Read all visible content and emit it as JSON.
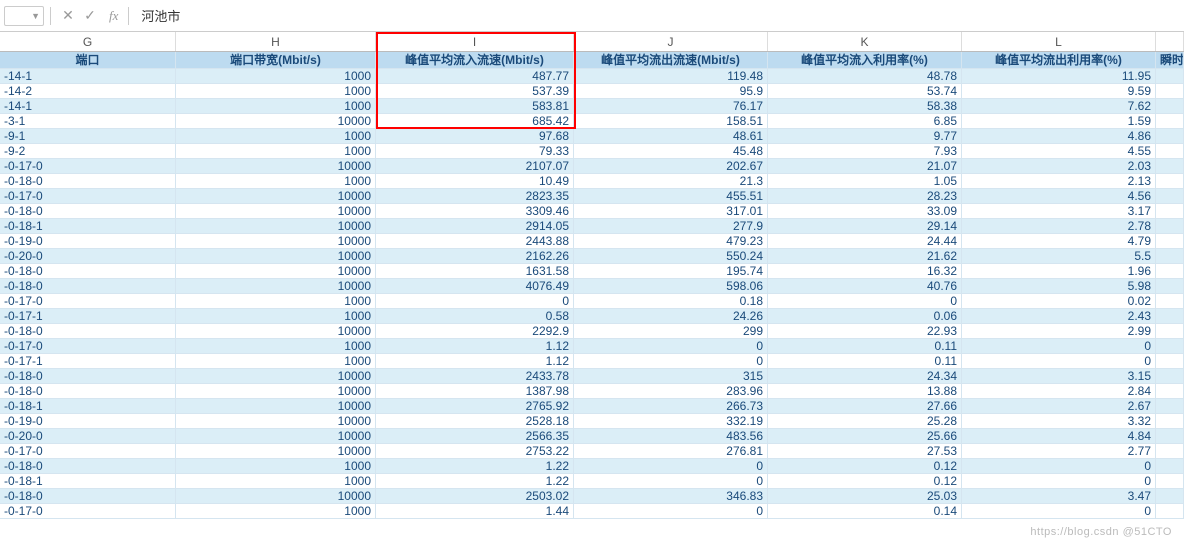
{
  "formula_bar": {
    "cell_value": "河池市",
    "fx_label": "fx",
    "dropdown_glyph": "▼",
    "cancel_glyph": "✕",
    "confirm_glyph": "✓"
  },
  "columns": {
    "G": "G",
    "H": "H",
    "I": "I",
    "J": "J",
    "K": "K",
    "L": "L",
    "M": ""
  },
  "headers": {
    "G": "端口",
    "H": "端口带宽(Mbit/s)",
    "I": "峰值平均流入流速(Mbit/s)",
    "J": "峰值平均流出流速(Mbit/s)",
    "K": "峰值平均流入利用率(%)",
    "L": "峰值平均流出利用率(%)",
    "M": "瞬时"
  },
  "rows": [
    {
      "G": "-14-1",
      "H": "1000",
      "I": "487.77",
      "J": "119.48",
      "K": "48.78",
      "L": "11.95"
    },
    {
      "G": "-14-2",
      "H": "1000",
      "I": "537.39",
      "J": "95.9",
      "K": "53.74",
      "L": "9.59"
    },
    {
      "G": "-14-1",
      "H": "1000",
      "I": "583.81",
      "J": "76.17",
      "K": "58.38",
      "L": "7.62"
    },
    {
      "G": "-3-1",
      "H": "10000",
      "I": "685.42",
      "J": "158.51",
      "K": "6.85",
      "L": "1.59"
    },
    {
      "G": "-9-1",
      "H": "1000",
      "I": "97.68",
      "J": "48.61",
      "K": "9.77",
      "L": "4.86"
    },
    {
      "G": "-9-2",
      "H": "1000",
      "I": "79.33",
      "J": "45.48",
      "K": "7.93",
      "L": "4.55"
    },
    {
      "G": "-0-17-0",
      "H": "10000",
      "I": "2107.07",
      "J": "202.67",
      "K": "21.07",
      "L": "2.03"
    },
    {
      "G": "-0-18-0",
      "H": "1000",
      "I": "10.49",
      "J": "21.3",
      "K": "1.05",
      "L": "2.13"
    },
    {
      "G": "-0-17-0",
      "H": "10000",
      "I": "2823.35",
      "J": "455.51",
      "K": "28.23",
      "L": "4.56"
    },
    {
      "G": "-0-18-0",
      "H": "10000",
      "I": "3309.46",
      "J": "317.01",
      "K": "33.09",
      "L": "3.17"
    },
    {
      "G": "-0-18-1",
      "H": "10000",
      "I": "2914.05",
      "J": "277.9",
      "K": "29.14",
      "L": "2.78"
    },
    {
      "G": "-0-19-0",
      "H": "10000",
      "I": "2443.88",
      "J": "479.23",
      "K": "24.44",
      "L": "4.79"
    },
    {
      "G": "-0-20-0",
      "H": "10000",
      "I": "2162.26",
      "J": "550.24",
      "K": "21.62",
      "L": "5.5"
    },
    {
      "G": "-0-18-0",
      "H": "10000",
      "I": "1631.58",
      "J": "195.74",
      "K": "16.32",
      "L": "1.96"
    },
    {
      "G": "-0-18-0",
      "H": "10000",
      "I": "4076.49",
      "J": "598.06",
      "K": "40.76",
      "L": "5.98"
    },
    {
      "G": "-0-17-0",
      "H": "1000",
      "I": "0",
      "J": "0.18",
      "K": "0",
      "L": "0.02"
    },
    {
      "G": "-0-17-1",
      "H": "1000",
      "I": "0.58",
      "J": "24.26",
      "K": "0.06",
      "L": "2.43"
    },
    {
      "G": "-0-18-0",
      "H": "10000",
      "I": "2292.9",
      "J": "299",
      "K": "22.93",
      "L": "2.99"
    },
    {
      "G": "-0-17-0",
      "H": "1000",
      "I": "1.12",
      "J": "0",
      "K": "0.11",
      "L": "0"
    },
    {
      "G": "-0-17-1",
      "H": "1000",
      "I": "1.12",
      "J": "0",
      "K": "0.11",
      "L": "0"
    },
    {
      "G": "-0-18-0",
      "H": "10000",
      "I": "2433.78",
      "J": "315",
      "K": "24.34",
      "L": "3.15"
    },
    {
      "G": "-0-18-0",
      "H": "10000",
      "I": "1387.98",
      "J": "283.96",
      "K": "13.88",
      "L": "2.84"
    },
    {
      "G": "-0-18-1",
      "H": "10000",
      "I": "2765.92",
      "J": "266.73",
      "K": "27.66",
      "L": "2.67"
    },
    {
      "G": "-0-19-0",
      "H": "10000",
      "I": "2528.18",
      "J": "332.19",
      "K": "25.28",
      "L": "3.32"
    },
    {
      "G": "-0-20-0",
      "H": "10000",
      "I": "2566.35",
      "J": "483.56",
      "K": "25.66",
      "L": "4.84"
    },
    {
      "G": "-0-17-0",
      "H": "10000",
      "I": "2753.22",
      "J": "276.81",
      "K": "27.53",
      "L": "2.77"
    },
    {
      "G": "-0-18-0",
      "H": "1000",
      "I": "1.22",
      "J": "0",
      "K": "0.12",
      "L": "0"
    },
    {
      "G": "-0-18-1",
      "H": "1000",
      "I": "1.22",
      "J": "0",
      "K": "0.12",
      "L": "0"
    },
    {
      "G": "-0-18-0",
      "H": "10000",
      "I": "2503.02",
      "J": "346.83",
      "K": "25.03",
      "L": "3.47"
    },
    {
      "G": "-0-17-0",
      "H": "1000",
      "I": "1.44",
      "J": "0",
      "K": "0.14",
      "L": "0"
    }
  ],
  "watermark": "https://blog.csdn  @51CTO"
}
